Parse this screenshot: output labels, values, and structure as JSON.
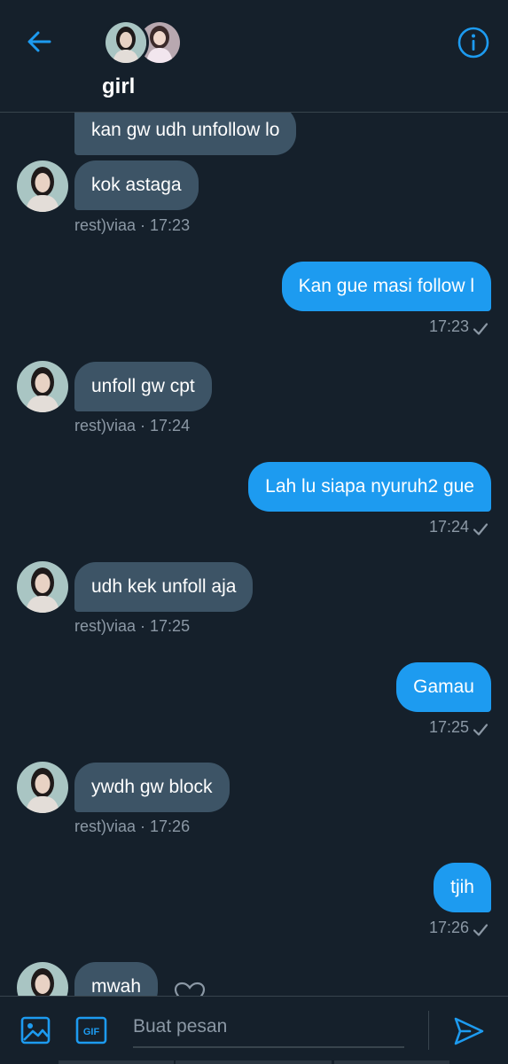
{
  "header": {
    "title": "girl",
    "back_icon": "arrow-left-icon",
    "info_icon": "info-icon",
    "accent": "#1d9bf0"
  },
  "messages": [
    {
      "dir": "in",
      "text": "kan gw udh unfollow lo"
    },
    {
      "dir": "in",
      "text": "kok astaga",
      "sender": "rest)viaa",
      "time": "17:23"
    },
    {
      "dir": "out",
      "text": "Kan gue masi follow l",
      "time": "17:23",
      "status": "sent"
    },
    {
      "dir": "in",
      "text": "unfoll gw cpt",
      "sender": "rest)viaa",
      "time": "17:24"
    },
    {
      "dir": "out",
      "text": "Lah lu siapa nyuruh2 gue",
      "time": "17:24",
      "status": "sent"
    },
    {
      "dir": "in",
      "text": "udh kek unfoll aja",
      "sender": "rest)viaa",
      "time": "17:25"
    },
    {
      "dir": "out",
      "text": "Gamau",
      "time": "17:25",
      "status": "sent"
    },
    {
      "dir": "in",
      "text": "ywdh gw block",
      "sender": "rest)viaa",
      "time": "17:26"
    },
    {
      "dir": "out",
      "text": "tjih",
      "time": "17:26",
      "status": "sent"
    },
    {
      "dir": "in",
      "text": "mwah"
    }
  ],
  "composer": {
    "placeholder": "Buat pesan",
    "image_icon": "image-icon",
    "gif_icon": "gif-icon",
    "gif_label": "GIF",
    "send_icon": "send-icon"
  },
  "colors": {
    "background": "#15202b",
    "incoming_bubble": "#3d5466",
    "outgoing_bubble": "#1d9bf0",
    "meta_text": "#8b98a5",
    "divider": "#38444d"
  }
}
